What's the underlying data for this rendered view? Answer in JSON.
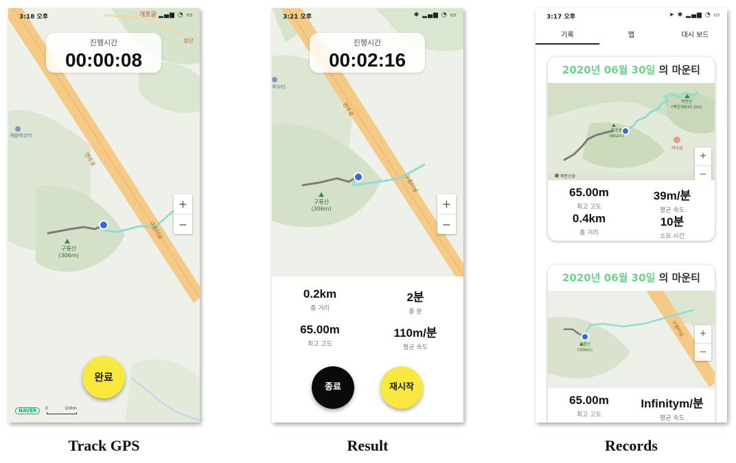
{
  "screens": {
    "track": {
      "status_time": "3:18 오후",
      "timer_label": "진행시간",
      "timer_value": "00:00:08",
      "done_button": "완료",
      "map_labels": {
        "road": "연주로",
        "road2": "구룡터널",
        "mountain": "구룡산",
        "mountain_height": "(306m)",
        "spring": "개암약수터",
        "top_place": "개포골",
        "top_place2": "성산"
      },
      "naver": "NAVER",
      "scale_0": "0",
      "scale_100": "100m",
      "caption": "Track GPS"
    },
    "result": {
      "status_time": "3:21 오후",
      "timer_label": "진행시간",
      "timer_value": "00:02:16",
      "map_labels": {
        "road": "연주로",
        "road2": "구룡터널",
        "mountain": "구룡산",
        "mountain_height": "(306m)",
        "spring": "약수터"
      },
      "stats": [
        {
          "value": "0.2km",
          "label": "총 거리"
        },
        {
          "value": "2분",
          "label": "총 분"
        },
        {
          "value": "65.00m",
          "label": "최고 고도"
        },
        {
          "value": "110m/분",
          "label": "평균 속도"
        }
      ],
      "stop_button": "종료",
      "restart_button": "재시작",
      "caption": "Result"
    },
    "records": {
      "status_time": "3:17 오후",
      "tabs": [
        "기록",
        "맵",
        "대시 보드"
      ],
      "cards": [
        {
          "title_date": "2020년 06월 30일",
          "title_suffix": "의 마운티",
          "map_labels": {
            "peak1": "북한산",
            "peak1_sub": "(백운대835.5m)",
            "peak2": "영초봉",
            "peak2_sub": "(662m)",
            "spring": "약수암",
            "fort": "북한산성"
          },
          "stats": [
            {
              "value": "65.00m",
              "label": "최고 고도"
            },
            {
              "value": "39m/분",
              "label": "평균 속도"
            },
            {
              "value": "0.4km",
              "label": "총 거리"
            },
            {
              "value": "10분",
              "label": "소요 시간"
            }
          ]
        },
        {
          "title_date": "2020년 06월 30일",
          "title_suffix": "의 마운티",
          "map_labels": {
            "road2": "구룡터널",
            "mountain": "구룡산",
            "mountain_height": "(306m)"
          },
          "stats": [
            {
              "value": "65.00m",
              "label": "최고 고도"
            },
            {
              "value": "Infinitym/분",
              "label": "평균 속도"
            }
          ]
        }
      ],
      "caption": "Records"
    }
  },
  "zoom": {
    "plus": "+",
    "minus": "−"
  },
  "colors": {
    "accent_yellow": "#f9e83d",
    "track_blue": "#2c6ee0",
    "path_teal": "#8fdcd2",
    "road": "#f5c986",
    "title_green": "#6cd38a"
  }
}
